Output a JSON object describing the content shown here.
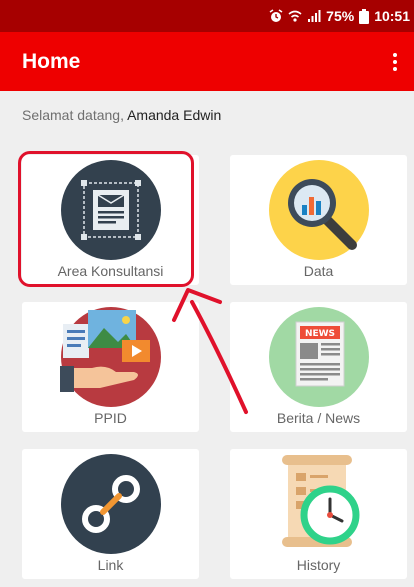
{
  "status_bar": {
    "battery_percent": "75%",
    "time": "10:51",
    "icons": [
      "alarm-icon",
      "wifi-icon",
      "signal-icon",
      "battery-icon"
    ]
  },
  "app_bar": {
    "title": "Home",
    "menu_icon": "overflow-menu-icon"
  },
  "welcome": {
    "greeting": "Selamat datang, ",
    "user_name": "Amanda Edwin"
  },
  "grid": [
    {
      "label": "Area Konsultansi",
      "icon": "document-frame-icon"
    },
    {
      "label": "Data",
      "icon": "magnifier-chart-icon"
    },
    {
      "label": "PPID",
      "icon": "media-hand-icon"
    },
    {
      "label": "Berita / News",
      "icon": "newspaper-icon"
    },
    {
      "label": "Link",
      "icon": "chain-link-icon"
    },
    {
      "label": "History",
      "icon": "scroll-clock-icon"
    }
  ],
  "colors": {
    "status_bar": "#a60000",
    "app_bar": "#ee0000",
    "annotation": "#e0112b",
    "background": "#efefef"
  }
}
